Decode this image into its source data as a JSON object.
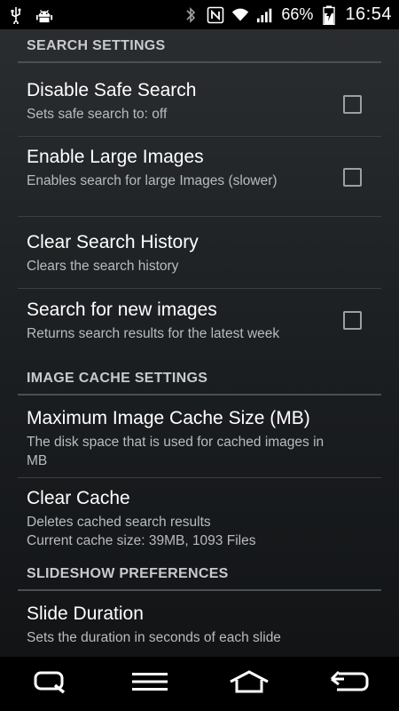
{
  "status_bar": {
    "icons_left": [
      "usb-icon",
      "android-debug-icon"
    ],
    "icons_right": [
      "bluetooth-icon",
      "nfc-icon",
      "wifi-icon",
      "signal-icon",
      "battery-charging-icon"
    ],
    "battery_percent": "66%",
    "time": "16:54"
  },
  "sections": {
    "search": {
      "header": "SEARCH SETTINGS",
      "items": [
        {
          "title": "Disable Safe Search",
          "summary": "Sets safe search to: off",
          "checked": false
        },
        {
          "title": "Enable Large Images",
          "summary": "Enables search for large Images (slower)",
          "checked": false
        },
        {
          "title": "Clear Search History",
          "summary": "Clears the search history"
        },
        {
          "title": "Search for new images",
          "summary": "Returns search results for the latest week",
          "checked": false
        }
      ]
    },
    "cache": {
      "header": "IMAGE CACHE SETTINGS",
      "items": [
        {
          "title": "Maximum Image Cache Size (MB)",
          "summary": "The disk space that is used for cached images in MB"
        },
        {
          "title": "Clear Cache",
          "summary_line1": "Deletes cached search results",
          "summary_line2": "Current cache size: 39MB, 1093 Files"
        }
      ]
    },
    "slideshow": {
      "header": "SLIDESHOW PREFERENCES",
      "items": [
        {
          "title": "Slide Duration",
          "summary": "Sets the duration in seconds of each slide"
        }
      ]
    }
  },
  "nav_bar": {
    "buttons": [
      "qslide-icon",
      "menu-icon",
      "home-icon",
      "back-icon"
    ]
  },
  "colors": {
    "background_top": "#2a2d30",
    "background_bottom": "#121416",
    "section_header_text": "#c8cacc",
    "summary_text": "#b9bcbf",
    "divider": "#4b4e52"
  }
}
